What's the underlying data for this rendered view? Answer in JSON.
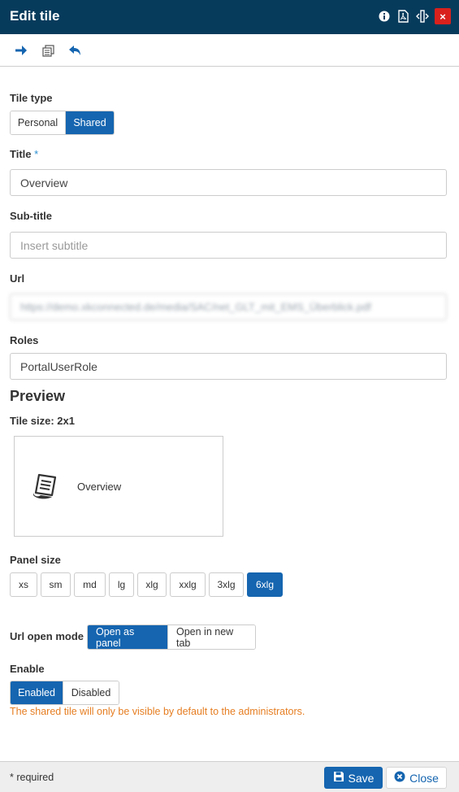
{
  "header": {
    "title": "Edit tile",
    "icons": [
      "info-icon",
      "pdf-icon",
      "resize-icon",
      "close-icon"
    ],
    "close_glyph": "×"
  },
  "toolbar": {
    "icons": [
      "arrow-right-icon",
      "copy-icon",
      "undo-icon"
    ]
  },
  "form": {
    "tile_type": {
      "label": "Tile type",
      "options": [
        "Personal",
        "Shared"
      ],
      "selected": "Shared"
    },
    "title": {
      "label": "Title",
      "required_mark": "*",
      "value": "Overview"
    },
    "subtitle": {
      "label": "Sub-title",
      "placeholder": "Insert subtitle"
    },
    "url": {
      "label": "Url",
      "value": "https://demo.xkconnected.de/media/SAC/net_GLT_mit_EMS_Überblick.pdf"
    },
    "roles": {
      "label": "Roles",
      "value": "PortalUserRole"
    }
  },
  "preview": {
    "heading": "Preview",
    "tile_size": "Tile size: 2x1",
    "tile_title": "Overview",
    "tile_icon": "document-scroll-icon"
  },
  "panel_size": {
    "label": "Panel size",
    "options": [
      "xs",
      "sm",
      "md",
      "lg",
      "xlg",
      "xxlg",
      "3xlg",
      "6xlg"
    ],
    "selected": "6xlg"
  },
  "url_open_mode": {
    "label": "Url open mode",
    "options": [
      "Open as panel",
      "Open in new tab"
    ],
    "selected": "Open as panel"
  },
  "enable": {
    "label": "Enable",
    "options": [
      "Enabled",
      "Disabled"
    ],
    "selected": "Enabled",
    "warning": "The shared tile will only be visible by default to the administrators."
  },
  "footer": {
    "required_note": "* required",
    "save_label": "Save",
    "close_label": "Close"
  },
  "colors": {
    "header_bg": "#073b5c",
    "accent": "#1565b0",
    "close_red": "#d9211c",
    "warning": "#e67e22"
  }
}
